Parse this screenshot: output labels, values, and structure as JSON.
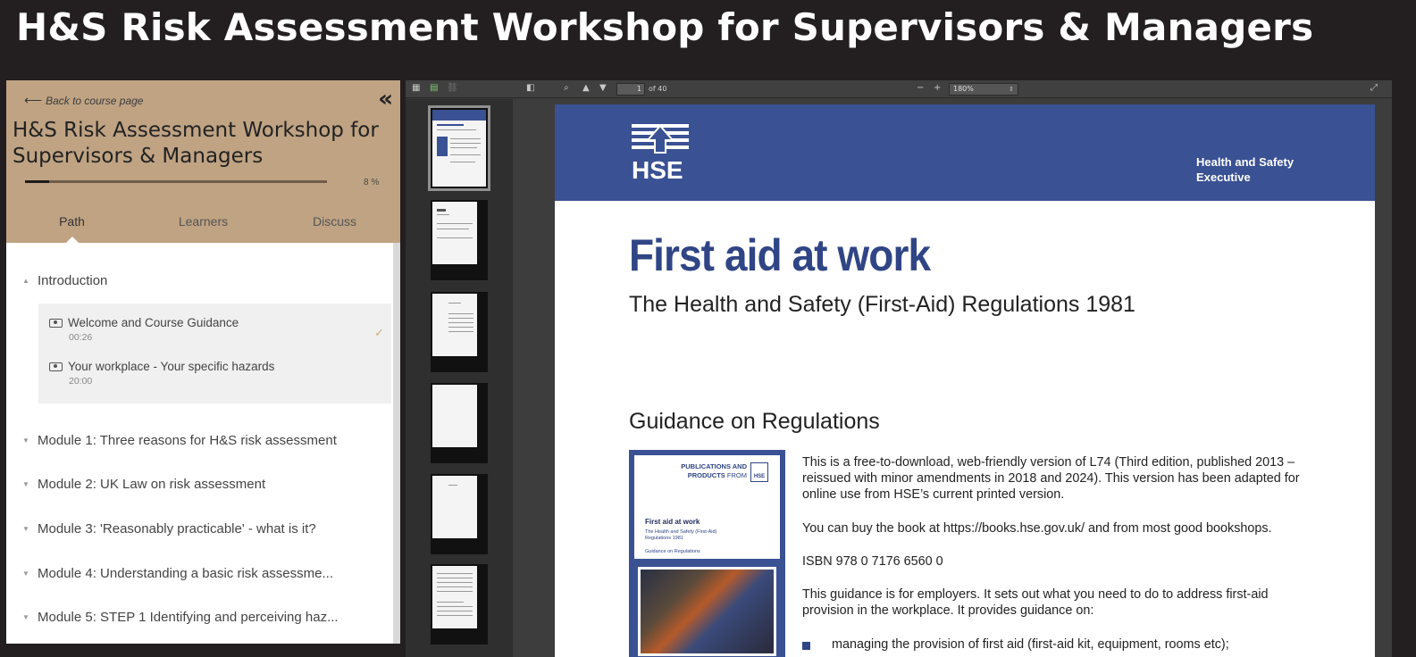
{
  "banner": {
    "title": "H&S Risk Assessment Workshop for Supervisors & Managers"
  },
  "course_panel": {
    "back_link": "Back to course page",
    "title": "H&S Risk Assessment Workshop for Supervisors & Managers",
    "progress_percent": 8,
    "progress_label": "8 %",
    "tabs": [
      "Path",
      "Learners",
      "Discuss"
    ],
    "active_tab": "Path",
    "sections": [
      {
        "title": "Introduction",
        "expanded": true,
        "lessons": [
          {
            "title": "Welcome and Course Guidance",
            "duration": "00:26",
            "completed": true
          },
          {
            "title": "Your workplace - Your specific hazards",
            "duration": "20:00",
            "completed": false
          }
        ]
      },
      {
        "title": "Module 1: Three reasons for H&S risk assessment",
        "expanded": false
      },
      {
        "title": "Module 2: UK Law on risk assessment",
        "expanded": false
      },
      {
        "title": "Module 3: 'Reasonably practicable' - what is it?",
        "expanded": false
      },
      {
        "title": "Module 4: Understanding a basic risk assessme...",
        "expanded": false
      },
      {
        "title": "Module 5: STEP 1 Identifying and perceiving haz...",
        "expanded": false
      }
    ],
    "colors": {
      "header_bg": "#bfa383",
      "check": "#c8b07a"
    }
  },
  "pdf_viewer": {
    "toolbar": {
      "current_page": "1",
      "page_of": "of 40",
      "zoom_minus": "−",
      "zoom_plus": "+",
      "zoom": "180%"
    },
    "thumbnail_count": 6,
    "selected_thumbnail": 1,
    "document": {
      "org_logo_text": "HSE",
      "org_name_line1": "Health and Safety",
      "org_name_line2": "Executive",
      "title": "First aid at work",
      "subtitle": "The Health and Safety (First-Aid) Regulations 1981",
      "guidance_heading": "Guidance on Regulations",
      "cover": {
        "publisher_line1": "PUBLICATIONS AND",
        "publisher_line2": "PRODUCTS",
        "publisher_from": "FROM",
        "mini_logo": "HSE",
        "title": "First aid at work",
        "subtitle": "The Health and Safety (First-Aid) Regulations 1981",
        "guidance": "Guidance on Regulations"
      },
      "paragraphs": [
        "This is a free-to-download, web-friendly version of L74 (Third edition, published 2013 – reissued with minor amendments in 2018 and 2024). This version has been adapted for online use from HSE’s current printed version.",
        "You can buy the book at https://books.hse.gov.uk/ and from most good bookshops.",
        "ISBN 978 0 7176 6560 0",
        "This guidance is for employers. It sets out what you need to do to address first-aid provision in the workplace. It provides guidance on:"
      ],
      "bullets": [
        "managing the provision of first aid (first-aid kit, equipment, rooms etc);"
      ],
      "colors": {
        "brand_blue": "#3a5193",
        "title_blue": "#2f4585"
      }
    }
  }
}
